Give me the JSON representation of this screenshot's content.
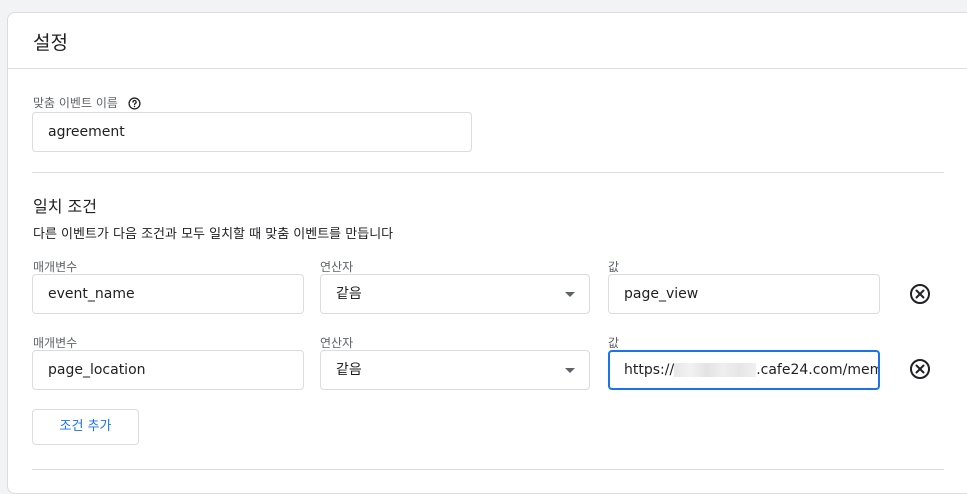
{
  "card": {
    "title": "설정"
  },
  "custom_event": {
    "label": "맞춤 이벤트 이름",
    "value": "agreement"
  },
  "match_conditions": {
    "title": "일치 조건",
    "description": "다른 이벤트가 다음 조건과 모두 일치할 때 맞춤 이벤트를 만듭니다",
    "rows": [
      {
        "parameter_label": "매개변수",
        "parameter_value": "event_name",
        "operator_label": "연산자",
        "operator_value": "같음",
        "value_label": "값",
        "value": "page_view"
      },
      {
        "parameter_label": "매개변수",
        "parameter_value": "page_location",
        "operator_label": "연산자",
        "operator_value": "같음",
        "value_label": "값",
        "value_prefix": "https://",
        "value_suffix": ".cafe24.com/mem"
      }
    ],
    "add_button": "조건 추가"
  },
  "icons": {
    "help": "help-circle-icon",
    "remove": "close-circle-icon",
    "dropdown": "dropdown-arrow-icon"
  },
  "colors": {
    "accent": "#1a73e8",
    "border": "#dadce0",
    "background": "#f1f3f4"
  }
}
